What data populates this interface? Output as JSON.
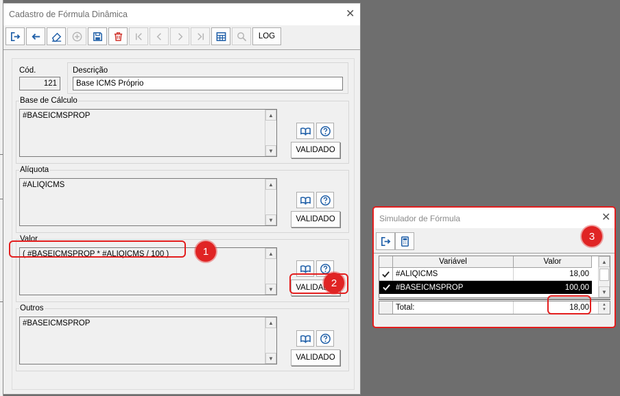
{
  "main_dialog": {
    "title": "Cadastro de Fórmula Dinâmica",
    "toolbar": {
      "log_label": "LOG",
      "icons": [
        "exit-icon",
        "back-arrow-icon",
        "eraser-icon",
        "add-icon",
        "save-icon",
        "delete-icon",
        "first-record-icon",
        "previous-record-icon",
        "next-record-icon",
        "last-record-icon",
        "table-icon",
        "search-icon"
      ]
    },
    "cod_label": "Cód.",
    "cod_value": "121",
    "descricao_label": "Descrição",
    "descricao_value": "Base ICMS Próprio",
    "sections": [
      {
        "label": "Base de Cálculo",
        "formula": "#BASEICMSPROP",
        "button": "VALIDADO"
      },
      {
        "label": "Alíquota",
        "formula": "#ALIQICMS",
        "button": "VALIDADO"
      },
      {
        "label": "Valor",
        "formula": "( #BASEICMSPROP * #ALIQICMS / 100 )",
        "button": "VALIDADO"
      },
      {
        "label": "Outros",
        "formula": "#BASEICMSPROP",
        "button": "VALIDADO"
      }
    ]
  },
  "simulator": {
    "title": "Simulador de Fórmula",
    "columns": [
      "Variável",
      "Valor"
    ],
    "rows": [
      {
        "variable": "#ALIQICMS",
        "value": "18,00",
        "selected": false
      },
      {
        "variable": "#BASEICMSPROP",
        "value": "100,00",
        "selected": true
      }
    ],
    "total_label": "Total:",
    "total_value": "18,00"
  },
  "callouts": [
    "1",
    "2",
    "3"
  ],
  "colors": {
    "highlight": "#e31d1d",
    "badge": "#e02424",
    "icon_blue": "#1f5fa8",
    "delete_red": "#d0342c"
  }
}
